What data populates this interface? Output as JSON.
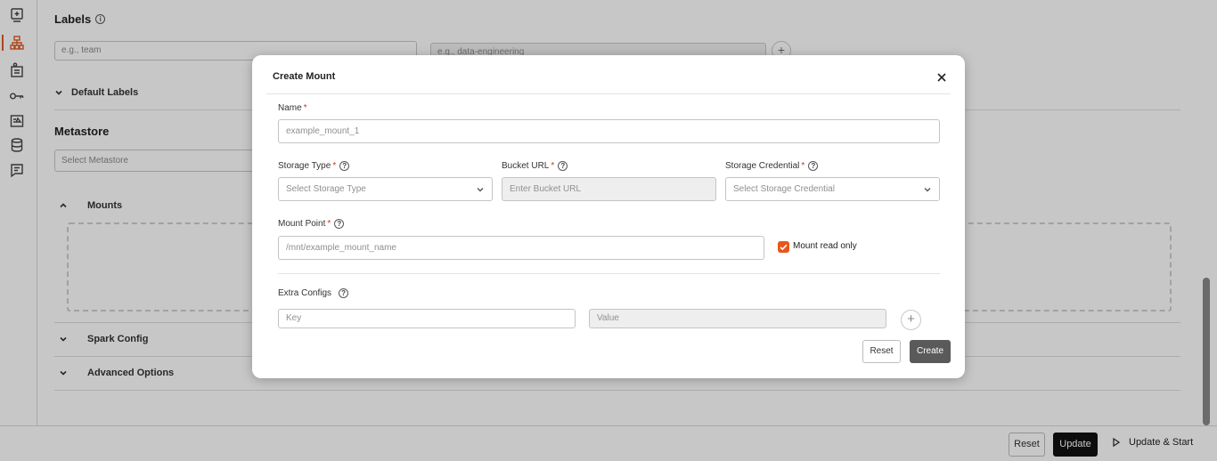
{
  "sidebar": {
    "items": [
      {
        "icon": "add-box-icon"
      },
      {
        "icon": "hierarchy-icon",
        "active": true
      },
      {
        "icon": "users-board-icon"
      },
      {
        "icon": "key-icon"
      },
      {
        "icon": "image-list-icon"
      },
      {
        "icon": "database-icon"
      },
      {
        "icon": "chat-list-icon"
      }
    ],
    "accent_color": "#e05a20"
  },
  "background": {
    "labels_title": "Labels",
    "label_key_placeholder": "e.g., team",
    "label_value_placeholder": "e.g., data-engineering",
    "default_labels": "Default Labels",
    "metastore_title": "Metastore",
    "metastore_placeholder": "Select Metastore",
    "mounts": "Mounts",
    "spark_config": "Spark Config",
    "advanced_options": "Advanced Options"
  },
  "footer": {
    "reset_label": "Reset",
    "update_label": "Update",
    "update_start_label": "Update & Start"
  },
  "modal": {
    "title": "Create Mount",
    "name_label": "Name",
    "name_placeholder": "example_mount_1",
    "storage_type_label": "Storage Type",
    "storage_type_placeholder": "Select Storage Type",
    "bucket_url_label": "Bucket URL",
    "bucket_url_placeholder": "Enter Bucket URL",
    "storage_credential_label": "Storage Credential",
    "storage_credential_placeholder": "Select Storage Credential",
    "mount_point_label": "Mount Point",
    "mount_point_placeholder": "/mnt/example_mount_name",
    "read_only_label": "Mount read only",
    "read_only_checked": true,
    "extra_configs_label": "Extra Configs",
    "key_placeholder": "Key",
    "value_placeholder": "Value",
    "reset_label": "Reset",
    "create_label": "Create",
    "required_mark": "*",
    "checkbox_color": "#e8561b"
  }
}
